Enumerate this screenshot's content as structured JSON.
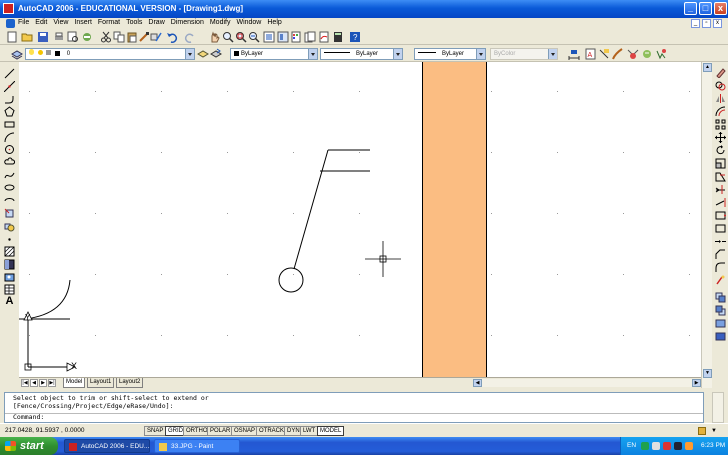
{
  "window": {
    "title": "AutoCAD 2006 - EDUCATIONAL VERSION - [Drawing1.dwg]",
    "controls": [
      "_",
      "□",
      "x"
    ]
  },
  "menu": {
    "items": [
      "File",
      "Edit",
      "View",
      "Insert",
      "Format",
      "Tools",
      "Draw",
      "Dimension",
      "Modify",
      "Window",
      "Help"
    ]
  },
  "layers": {
    "current_layer": "0",
    "color": "ByLayer",
    "linetype": "ByLayer",
    "lineweight": "ByLayer",
    "plotstyle": "ByColor"
  },
  "tabs": [
    "Model",
    "Layout1",
    "Layout2"
  ],
  "tab_nav": [
    "|◀",
    "◀",
    "▶",
    "▶|"
  ],
  "command": {
    "history": [
      "Select object to trim or shift-select to extend or",
      "[Fence/Crossing/Project/Edge/eRase/Undo]:"
    ],
    "prompt": "Command:"
  },
  "ucs": {
    "x_label": "X",
    "y_label": "Y"
  },
  "status": {
    "coordinates": "217.0428, 91.5937 , 0.0000",
    "toggles": [
      {
        "label": "SNAP",
        "on": false
      },
      {
        "label": "GRID",
        "on": true
      },
      {
        "label": "ORTHO",
        "on": false
      },
      {
        "label": "POLAR",
        "on": false
      },
      {
        "label": "OSNAP",
        "on": false
      },
      {
        "label": "OTRACK",
        "on": false
      },
      {
        "label": "DYN",
        "on": false
      },
      {
        "label": "LWT",
        "on": false
      },
      {
        "label": "MODEL",
        "on": true
      }
    ]
  },
  "taskbar": {
    "start_label": "start",
    "tasks": [
      {
        "label": "AutoCAD 2006 - EDU...",
        "active": true
      },
      {
        "label": "33.JPG - Paint",
        "active": false
      }
    ],
    "language": "EN",
    "clock": "6:23 PM"
  },
  "colors": {
    "accent_fill": "#fbbd82",
    "titlebar": "#0a5ad8",
    "taskbar": "#245dd8",
    "start_button": "#2f8f2f"
  }
}
